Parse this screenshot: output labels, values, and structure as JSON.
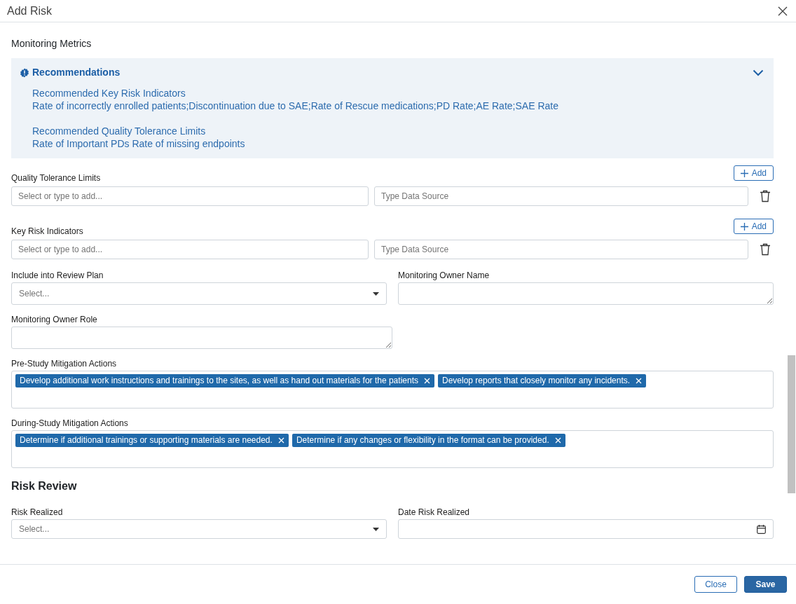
{
  "dialog": {
    "title": "Add Risk"
  },
  "section_title": "Monitoring Metrics",
  "recommendations": {
    "title": "Recommendations",
    "expanded": true,
    "groups": [
      {
        "heading": "Recommended Key Risk Indicators",
        "text": "Rate of incorrectly enrolled patients;Discontinuation due to SAE;Rate of Rescue medications;PD Rate;AE Rate;SAE Rate"
      },
      {
        "heading": "Recommended Quality Tolerance Limits",
        "text": "Rate of Important PDs Rate of missing endpoints"
      }
    ]
  },
  "metric_lists": [
    {
      "label": "Quality Tolerance Limits",
      "add_label": "Add",
      "rows": [
        {
          "placeholder": "Select or type to add...",
          "source_placeholder": "Type Data Source"
        }
      ]
    },
    {
      "label": "Key Risk Indicators",
      "add_label": "Add",
      "rows": [
        {
          "placeholder": "Select or type to add...",
          "source_placeholder": "Type Data Source"
        }
      ]
    }
  ],
  "form_rows": [
    [
      {
        "kind": "select",
        "label": "Include into Review Plan",
        "placeholder": "Select..."
      },
      {
        "kind": "textarea",
        "label": "Monitoring Owner Name"
      }
    ],
    [
      {
        "kind": "textarea",
        "label": "Monitoring Owner Role"
      }
    ],
    [
      {
        "kind": "tags",
        "label": "Pre-Study Mitigation Actions",
        "tags": [
          "Develop additional work instructions and trainings to the sites, as well as hand out materials for the patients",
          "Develop reports that closely monitor any incidents."
        ]
      }
    ],
    [
      {
        "kind": "tags",
        "label": "During-Study Mitigation Actions",
        "tags": [
          "Determine if additional trainings or supporting materials are needed.",
          "Determine if any changes or flexibility in the format can be provided."
        ]
      }
    ],
    [
      {
        "kind": "heading",
        "label": "Risk Review"
      }
    ],
    [
      {
        "kind": "select",
        "label": "Risk Realized",
        "placeholder": "Select..."
      },
      {
        "kind": "date",
        "label": "Date Risk Realized"
      }
    ]
  ],
  "footer_buttons": [
    {
      "kind": "outline",
      "label": "Close"
    },
    {
      "kind": "primary",
      "label": "Save"
    }
  ]
}
